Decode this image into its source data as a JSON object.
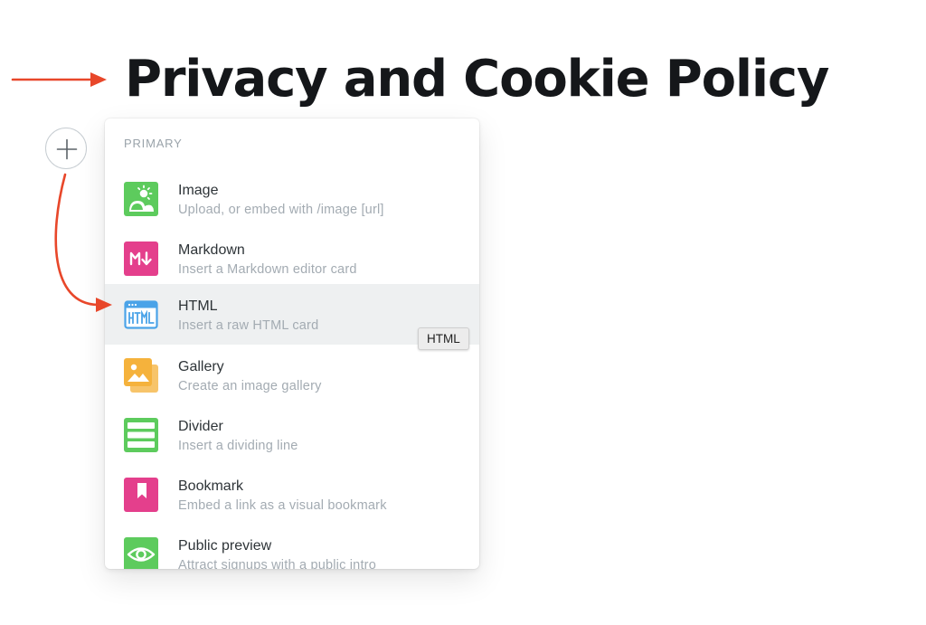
{
  "title": "Privacy and Cookie Policy",
  "menu": {
    "section_label": "PRIMARY",
    "items": [
      {
        "title": "Image",
        "description": "Upload, or embed with /image [url]",
        "icon": "image-icon",
        "color": "#5dcb5d"
      },
      {
        "title": "Markdown",
        "description": "Insert a Markdown editor card",
        "icon": "markdown-icon",
        "color": "#e43f8c"
      },
      {
        "title": "HTML",
        "description": "Insert a raw HTML card",
        "icon": "html-icon",
        "color": "#4aa3e8"
      },
      {
        "title": "Gallery",
        "description": "Create an image gallery",
        "icon": "gallery-icon",
        "color": "#f5b23c"
      },
      {
        "title": "Divider",
        "description": "Insert a dividing line",
        "icon": "divider-icon",
        "color": "#5dcb5d"
      },
      {
        "title": "Bookmark",
        "description": "Embed a link as a visual bookmark",
        "icon": "bookmark-icon",
        "color": "#e43f8c"
      },
      {
        "title": "Public preview",
        "description": "Attract signups with a public intro",
        "icon": "eye-icon",
        "color": "#5dcb5d"
      }
    ]
  },
  "tooltip": "HTML",
  "colors": {
    "annotation_arrow": "#e8472a",
    "active_row": "#eef0f1",
    "title": "#15171a"
  }
}
